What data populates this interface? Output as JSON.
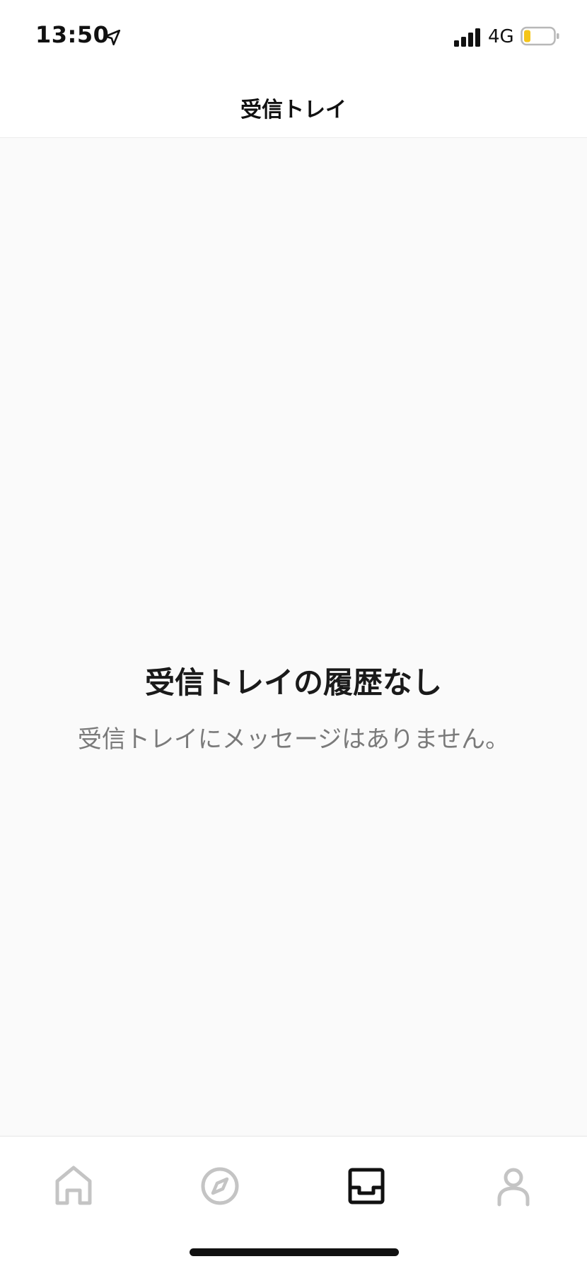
{
  "status_bar": {
    "time": "13:50",
    "network": "4G",
    "battery_color": "#f5c518"
  },
  "header": {
    "title": "受信トレイ"
  },
  "empty_state": {
    "title": "受信トレイの履歴なし",
    "message": "受信トレイにメッセージはありません。"
  },
  "tab_bar": {
    "active_color": "#111111",
    "inactive_color": "#c4c4c4",
    "tabs": [
      {
        "icon": "home-icon",
        "active": false
      },
      {
        "icon": "compass-icon",
        "active": false
      },
      {
        "icon": "inbox-icon",
        "active": true
      },
      {
        "icon": "profile-icon",
        "active": false
      }
    ]
  }
}
